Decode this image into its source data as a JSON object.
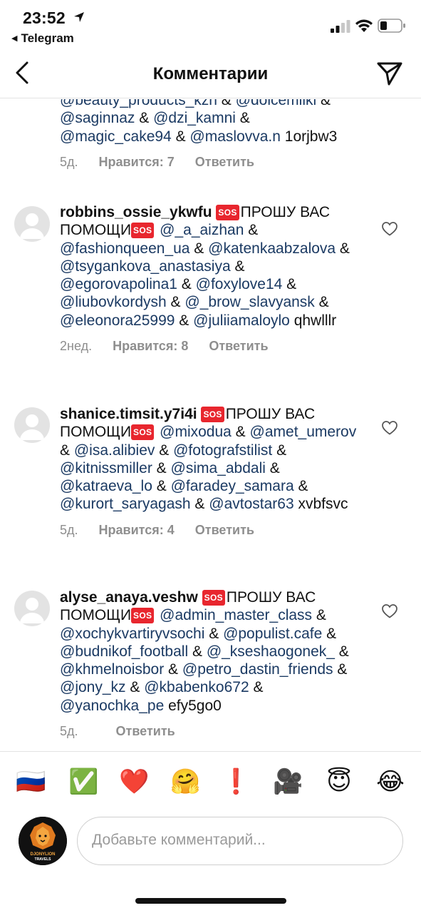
{
  "status_bar": {
    "time": "23:52",
    "back_app": "Telegram"
  },
  "header": {
    "title": "Комментарии"
  },
  "partial_comment": {
    "lines": [
      [
        "@beauty_products_kzn",
        " & ",
        "@dolcemilki",
        " &"
      ],
      [
        "@saginnaz",
        " & ",
        "@dzi_kamni",
        " &"
      ],
      [
        "@magic_cake94",
        " & ",
        "@maslovva.n",
        " 1orjbw3"
      ]
    ],
    "time": "5д.",
    "likes": "Нравится: 7",
    "reply": "Ответить"
  },
  "comments": [
    {
      "username": "robbins_ossie_ykwfu",
      "sos_label": "SOS",
      "plea": "ПРОШУ ВАС",
      "plea2": "ПОМОЩИ",
      "mentions": [
        "@_a_aizhan",
        "@fashionqueen_ua",
        "@katenkaabzalova",
        "@tsygankova_anastasiya",
        "@egorovapolina1",
        "@foxylove14",
        "@liubovkordysh",
        "@_brow_slavyansk",
        "@eleonora25999",
        "@juliiamaloylo"
      ],
      "tail": "qhwlllr",
      "time": "2нед.",
      "likes": "Нравится: 8",
      "reply": "Ответить"
    },
    {
      "username": "shanice.timsit.y7i4i",
      "sos_label": "SOS",
      "plea": "ПРОШУ ВАС",
      "plea2": "ПОМОЩИ",
      "mentions": [
        "@mixodua",
        "@amet_umerov",
        "@isa.alibiev",
        "@fotografstilist",
        "@kitnissmiller",
        "@sima_abdali",
        "@katraeva_lo",
        "@faradey_samara",
        "@kurort_saryagash",
        "@avtostar63"
      ],
      "tail": "xvbfsvc",
      "time": "5д.",
      "likes": "Нравится: 4",
      "reply": "Ответить"
    },
    {
      "username": "alyse_anaya.veshw",
      "sos_label": "SOS",
      "plea": "ПРОШУ ВАС",
      "plea2": "ПОМОЩИ",
      "mentions": [
        "@admin_master_class",
        "@xochykvartiryvsochi",
        "@populist.cafe",
        "@budnikof_football",
        "@_kseshaogonek_",
        "@khmelnoisbor",
        "@petro_dastin_friends",
        "@jony_kz",
        "@kbabenko672",
        "@yanochka_pe"
      ],
      "tail": "efy5go0",
      "time": "5д.",
      "likes": "",
      "reply": "Ответить"
    }
  ],
  "emoji_bar": [
    "🇷🇺",
    "✅",
    "❤️",
    "🤗",
    "❗",
    "🎥",
    "😇",
    "😂"
  ],
  "composer": {
    "placeholder": "Добавьте комментарий...",
    "avatar_logo": "DJONYLION TRAVELS"
  },
  "colors": {
    "mention": "#1b3a63",
    "meta": "#8e8e8e",
    "sos": "#e8262e"
  }
}
